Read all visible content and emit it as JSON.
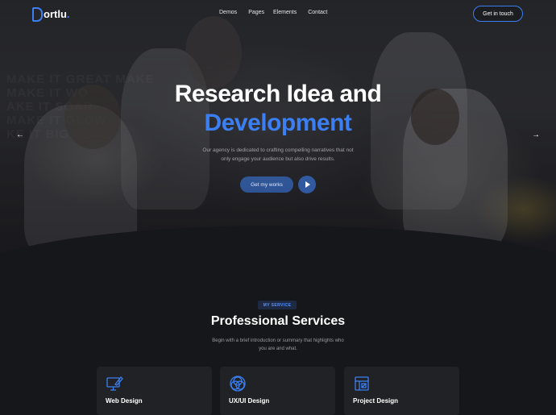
{
  "brand": {
    "name": "ortlu",
    "accent": "#3b7ff2"
  },
  "nav": {
    "items": [
      {
        "label": "Demos"
      },
      {
        "label": "Pages"
      },
      {
        "label": "Elements"
      },
      {
        "label": "Contact"
      }
    ],
    "cta_label": "Get in touch"
  },
  "hero": {
    "wall_text": "MAKE IT GREAT MAKE IT WORK MAKE IT SOAR MAKE IT GLOW MAKE IT BIG",
    "title_line1": "Research Idea and",
    "title_line2": "Development",
    "subtitle": "Our agency is dedicated to crafting compelling narratives that not only engage your audience but also drive results.",
    "primary_button": "Get my works",
    "prev_arrow": "←",
    "next_arrow": "→"
  },
  "services": {
    "badge": "MY SERVICE",
    "title": "Professional Services",
    "subtitle": "Begin with a brief introduction or summary that highlights who you are and what.",
    "cards": [
      {
        "title": "Web Design",
        "icon": "monitor-pen-icon"
      },
      {
        "title": "UX/UI Design",
        "icon": "venn-circles-icon"
      },
      {
        "title": "Project Design",
        "icon": "blueprint-icon"
      }
    ]
  }
}
